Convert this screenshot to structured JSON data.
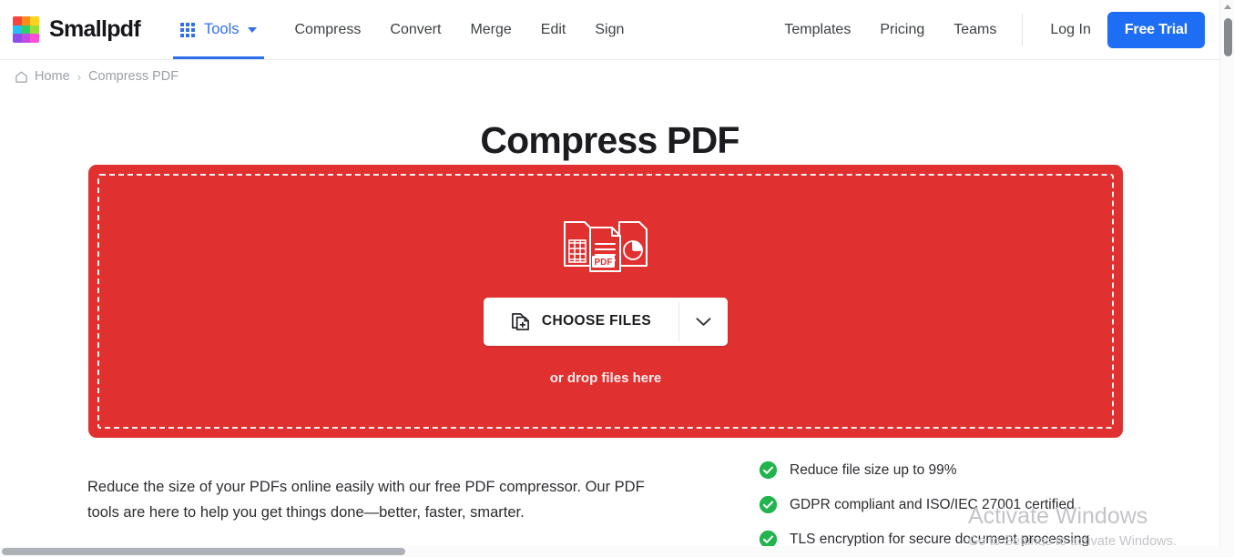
{
  "brand": {
    "name": "Smallpdf",
    "logo_colors": [
      "#f5453d",
      "#ff8c1a",
      "#ffd21e",
      "#25c0f0",
      "#2fd06a",
      "#9ade3a",
      "#8f4ee8",
      "#c24ce8",
      "#ff4fd8"
    ]
  },
  "nav": {
    "tools_label": "Tools",
    "links": [
      "Compress",
      "Convert",
      "Merge",
      "Edit",
      "Sign"
    ],
    "right_links": [
      "Templates",
      "Pricing",
      "Teams"
    ],
    "login_label": "Log In",
    "free_trial_label": "Free Trial",
    "accent_blue": "#1d6df5"
  },
  "breadcrumb": {
    "home_label": "Home",
    "separator": "›",
    "current": "Compress PDF"
  },
  "main": {
    "title": "Compress PDF",
    "dropzone": {
      "background": "#e03030",
      "choose_files_label": "CHOOSE FILES",
      "drop_hint": "or drop files here",
      "pdf_badge": "PDF"
    },
    "blurb": "Reduce the size of your PDFs online easily with our free PDF compressor. Our PDF tools are here to help you get things done—better, faster, smarter.",
    "features": [
      "Reduce file size up to 99%",
      "GDPR compliant and ISO/IEC 27001 certified",
      "TLS encryption for secure document processing"
    ],
    "feature_check_color": "#22b44e"
  },
  "watermark": {
    "title": "Activate Windows",
    "subtitle": "Go to Settings to activate Windows."
  }
}
